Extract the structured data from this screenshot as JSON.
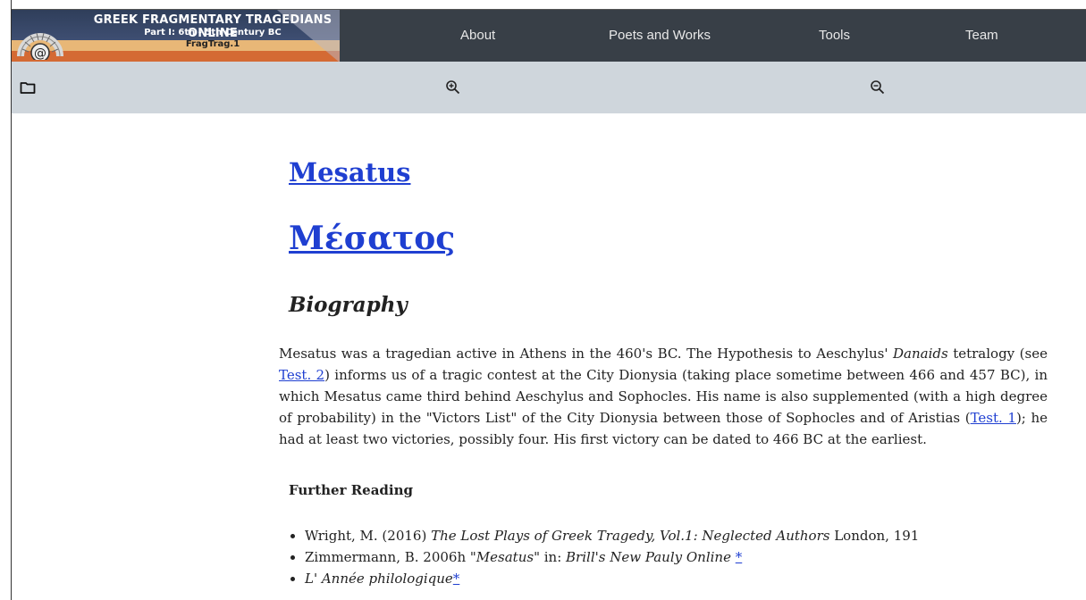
{
  "header": {
    "logo": {
      "title": "GREEK FRAGMENTARY TRAGEDIANS ONLINE",
      "subtitle": "Part I: 6th - 5th Century BC",
      "tag": "FragTrag.1"
    },
    "nav": [
      "About",
      "Poets and Works",
      "Tools",
      "Team"
    ]
  },
  "toolbar": {
    "icons": [
      "folder-icon",
      "zoom-in-icon",
      "zoom-out-icon"
    ]
  },
  "page": {
    "title_latin": "Mesatus",
    "title_greek": "Μέσατος",
    "section_heading": "Biography",
    "biography": {
      "p1": "Mesatus was a tragedian active in Athens in the 460's BC. The Hypothesis to Aeschylus' ",
      "danaids": "Danaids",
      "p2": " tetralogy (see ",
      "link_test2": "Test. 2",
      "p3": ") informs us of a tragic contest at the City Dionysia (taking place sometime between 466 and 457 BC), in which Mesatus came third behind Aeschylus and Sophocles. His name is also supplemented (with a high degree of probability) in the \"Victors List\" of the City Dionysia between those of Sophocles and of Aristias (",
      "link_test1": "Test. 1",
      "p4": "); he had at least two victories, possibly four. His first victory can be dated to 466 BC at the earliest."
    },
    "further_reading_label": "Further Reading",
    "references": [
      {
        "pre": "Wright, M. (2016) ",
        "title": "The Lost Plays of Greek Tragedy, Vol.1: Neglected Authors",
        "post": " London, 191",
        "link": ""
      },
      {
        "pre": "Zimmermann, B. 2006h ",
        "title": "\"Mesatus\"",
        "mid": " in: ",
        "title2": "Brill's New Pauly Online",
        "post": " ",
        "link": "*"
      },
      {
        "pre": "",
        "title": "L' Année philologique",
        "post": "",
        "link": "*"
      }
    ]
  }
}
